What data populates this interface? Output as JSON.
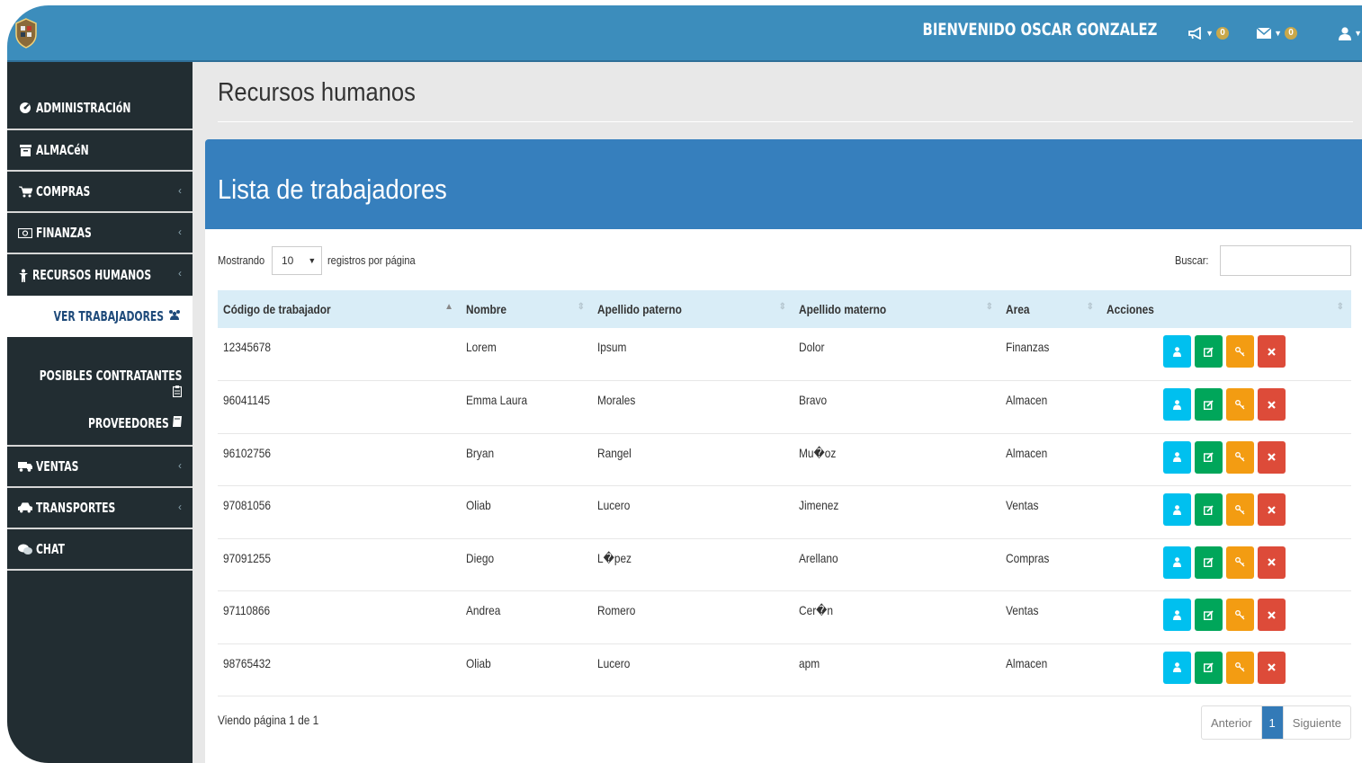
{
  "header": {
    "welcome": "BIENVENIDO OSCAR GONZALEZ",
    "notifications_count": "0",
    "messages_count": "0"
  },
  "sidebar": {
    "items": [
      {
        "label": "ADMINISTRACIóN",
        "icon": "dashboard-icon"
      },
      {
        "label": "ALMACéN",
        "icon": "archive-icon"
      },
      {
        "label": "COMPRAS",
        "icon": "cart-icon"
      },
      {
        "label": "FINANZAS",
        "icon": "money-icon"
      },
      {
        "label": "RECURSOS HUMANOS",
        "icon": "person-icon"
      }
    ],
    "subitems": [
      {
        "label": "VER TRABAJADORES",
        "icon": "users-icon"
      },
      {
        "label": "POSIBLES CONTRATANTES",
        "icon": "clipboard-icon"
      },
      {
        "label": "PROVEEDORES",
        "icon": "book-icon"
      }
    ],
    "items2": [
      {
        "label": "VENTAS",
        "icon": "truck-icon"
      },
      {
        "label": "TRANSPORTES",
        "icon": "car-icon"
      },
      {
        "label": "CHAT",
        "icon": "chat-icon"
      }
    ]
  },
  "page": {
    "title": "Recursos humanos",
    "box_title": "Lista de trabajadores"
  },
  "table_controls": {
    "show_label": "Mostrando",
    "page_size": "10",
    "per_page_label": "registros por página",
    "search_label": "Buscar:"
  },
  "table": {
    "columns": [
      "Código de trabajador",
      "Nombre",
      "Apellido paterno",
      "Apellido materno",
      "Area",
      "Acciones"
    ],
    "rows": [
      [
        "12345678",
        "Lorem",
        "Ipsum",
        "Dolor",
        "Finanzas"
      ],
      [
        "96041145",
        "Emma Laura",
        "Morales",
        "Bravo",
        "Almacen"
      ],
      [
        "96102756",
        "Bryan",
        "Rangel",
        "Mu�oz",
        "Almacen"
      ],
      [
        "97081056",
        "Oliab",
        "Lucero",
        "Jimenez",
        "Ventas"
      ],
      [
        "97091255",
        "Diego",
        "L�pez",
        "Arellano",
        "Compras"
      ],
      [
        "97110866",
        "Andrea",
        "Romero",
        "Cer�n",
        "Ventas"
      ],
      [
        "98765432",
        "Oliab",
        "Lucero",
        "apm",
        "Almacen"
      ]
    ]
  },
  "footer": {
    "info": "Viendo página 1 de 1",
    "prev": "Anterior",
    "current": "1",
    "next": "Siguiente"
  },
  "colors": {
    "header": "#3c8dbc",
    "sidebar": "#222d32",
    "box_header": "#367fbd",
    "btn_info": "#00c0ef",
    "btn_success": "#00a65a",
    "btn_warning": "#f39c12",
    "btn_danger": "#dd4b39"
  }
}
